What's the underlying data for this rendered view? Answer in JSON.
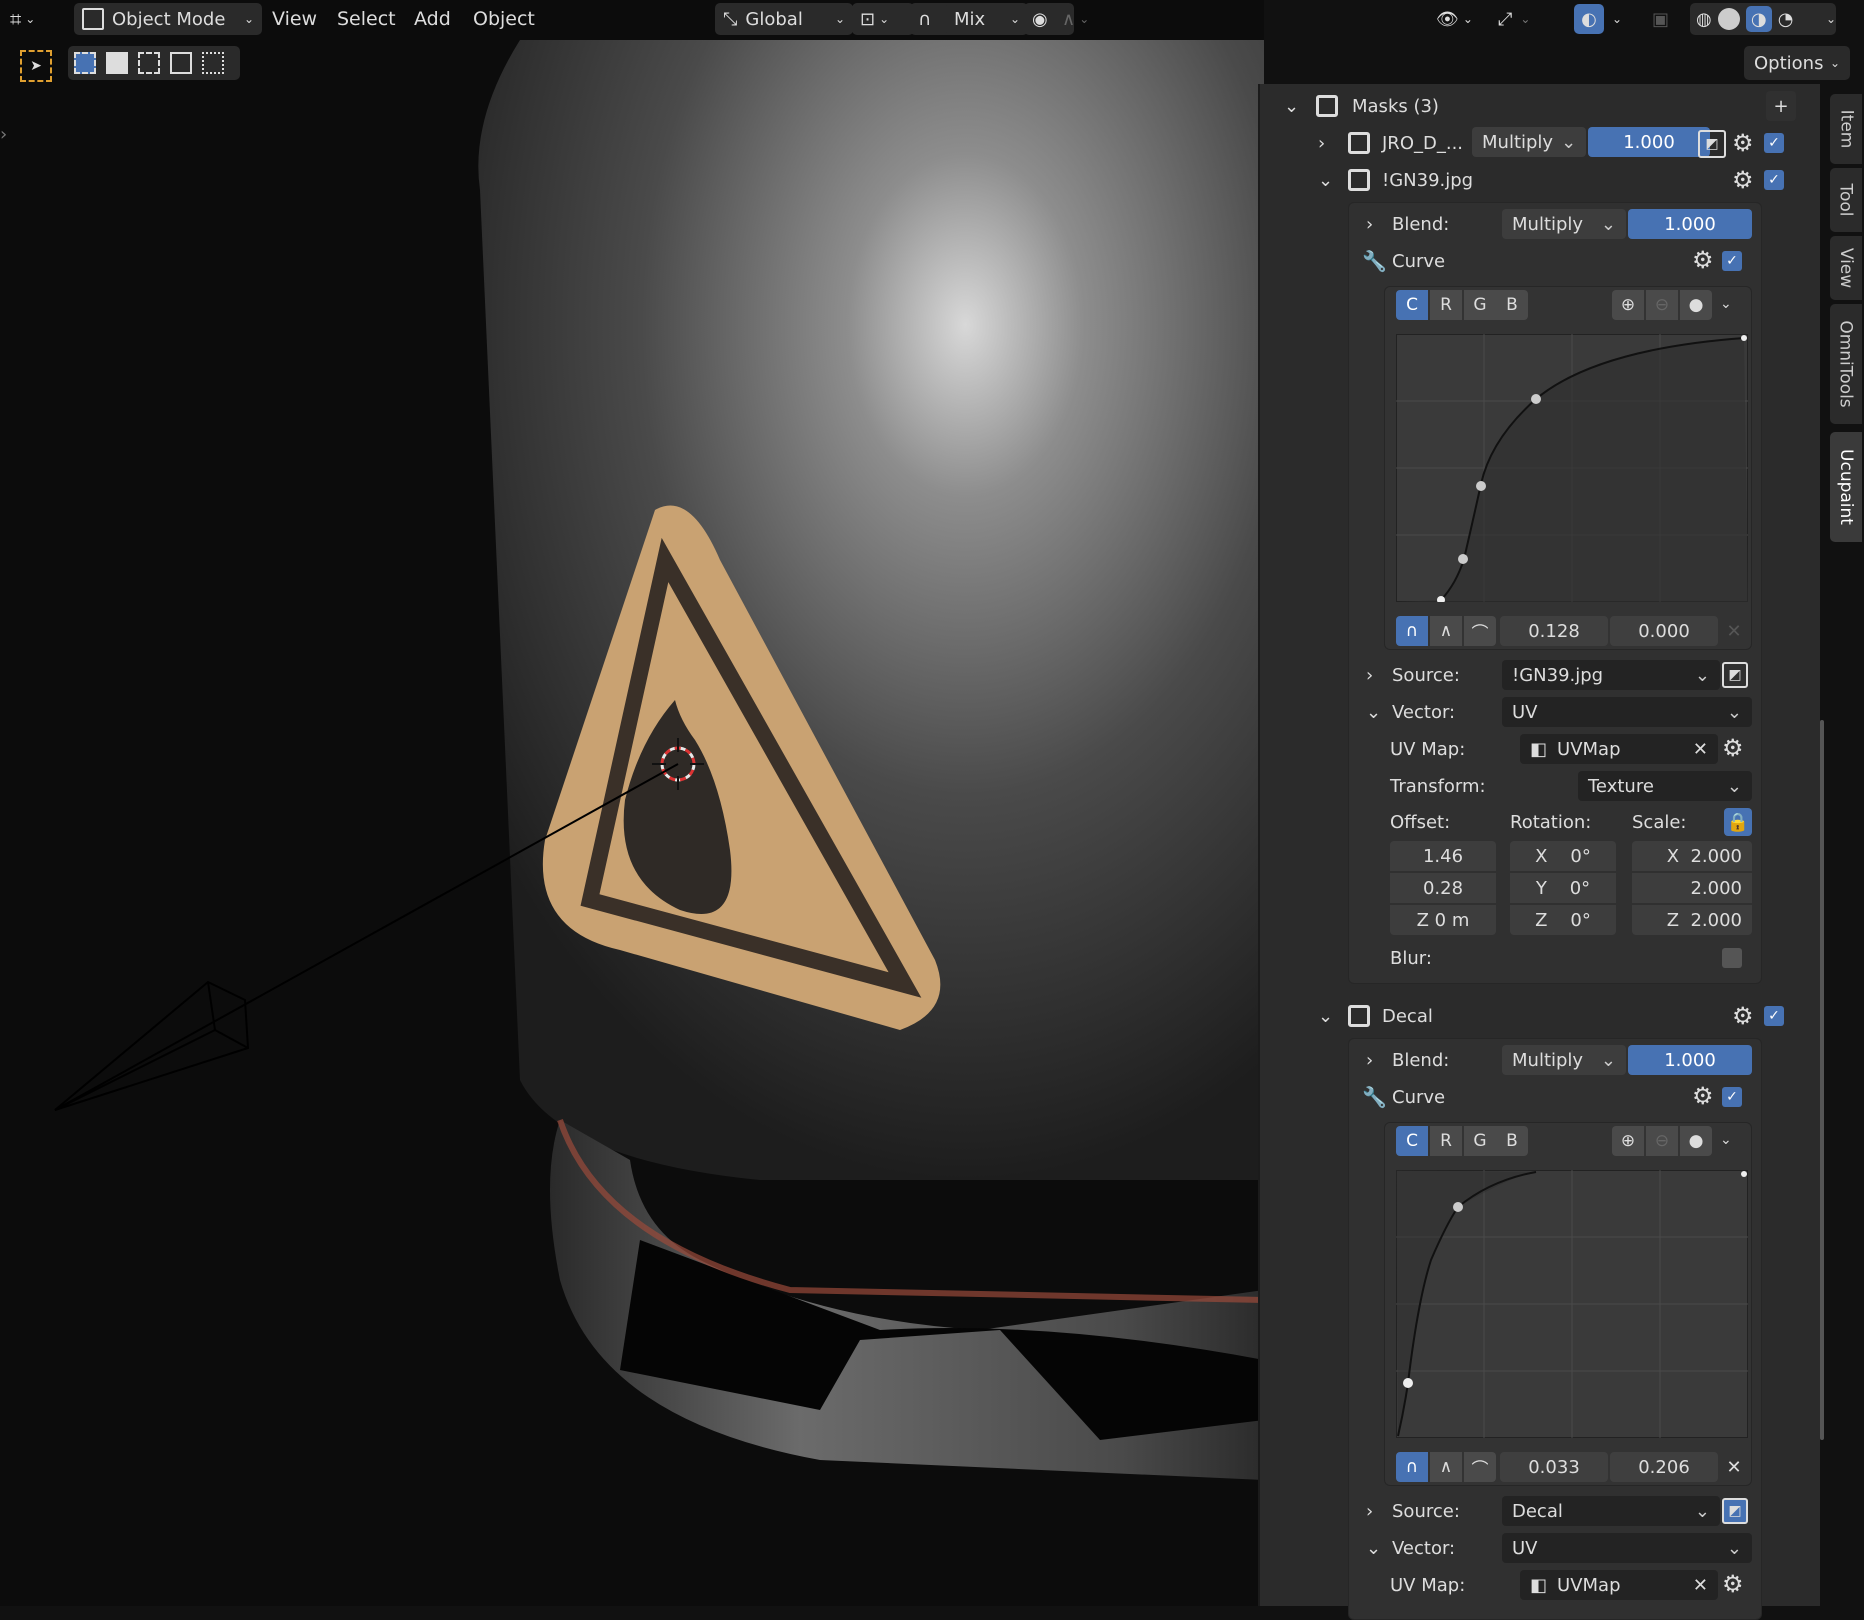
{
  "header": {
    "mode": "Object Mode",
    "menus": [
      "View",
      "Select",
      "Add",
      "Object"
    ],
    "orientation": "Global",
    "snap_mode": "Mix",
    "options": "Options"
  },
  "side_tabs": [
    "Item",
    "Tool",
    "View",
    "OmniTools",
    "Ucupaint"
  ],
  "masks": {
    "title": "Masks (3)",
    "items": [
      {
        "name": "JRO_D_...",
        "blend": "Multiply",
        "value": "1.000"
      },
      {
        "name": "!GN39.jpg"
      },
      {
        "name": "Decal"
      }
    ]
  },
  "gn39": {
    "blend_label": "Blend:",
    "blend": "Multiply",
    "blend_value": "1.000",
    "curve_label": "Curve",
    "channels": [
      "C",
      "R",
      "G",
      "B"
    ],
    "curve_x": "0.128",
    "curve_y": "0.000",
    "source_label": "Source:",
    "source": "!GN39.jpg",
    "vector_label": "Vector:",
    "vector": "UV",
    "uvmap_label": "UV Map:",
    "uvmap": "UVMap",
    "transform_label": "Transform:",
    "transform": "Texture",
    "offset_label": "Offset:",
    "rotation_label": "Rotation:",
    "scale_label": "Scale:",
    "offset": [
      "1.46",
      "0.28",
      "Z  0 m"
    ],
    "rotation": [
      "X    0°",
      "Y    0°",
      "Z    0°"
    ],
    "scale": [
      "X  2.000",
      "2.000",
      "Z  2.000"
    ],
    "blur_label": "Blur:"
  },
  "decal": {
    "blend_label": "Blend:",
    "blend": "Multiply",
    "blend_value": "1.000",
    "curve_label": "Curve",
    "channels": [
      "C",
      "R",
      "G",
      "B"
    ],
    "curve_x": "0.033",
    "curve_y": "0.206",
    "source_label": "Source:",
    "source": "Decal",
    "vector_label": "Vector:",
    "vector": "UV",
    "uvmap_label": "UV Map:",
    "uvmap": "UVMap"
  },
  "colors": {
    "accent": "#4772b3",
    "panel": "#2b2b2b",
    "field": "#3d3d3d"
  }
}
